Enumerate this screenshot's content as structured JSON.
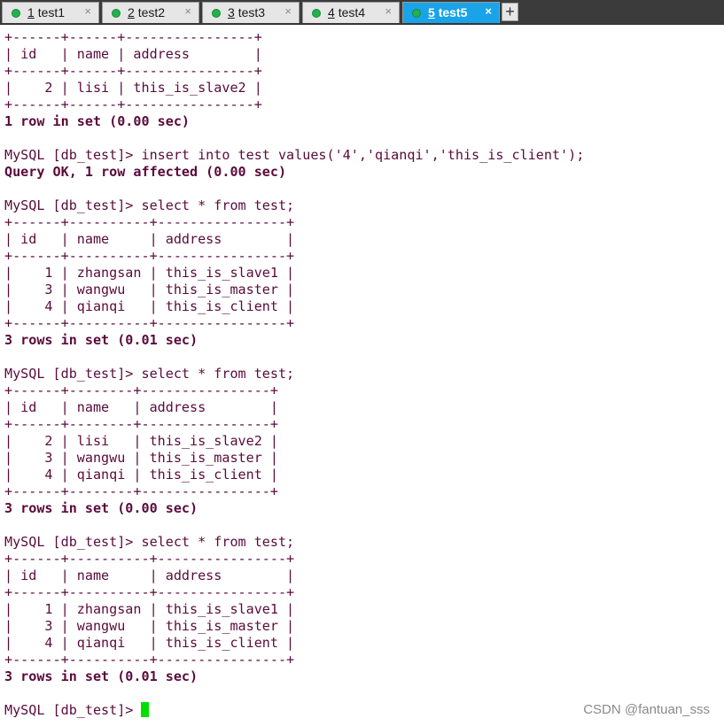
{
  "tabs": [
    {
      "number": "1",
      "name": "test1",
      "close": "×",
      "status_color": "#22b14c"
    },
    {
      "number": "2",
      "name": "test2",
      "close": "×",
      "status_color": "#22b14c"
    },
    {
      "number": "3",
      "name": "test3",
      "close": "×",
      "status_color": "#22b14c"
    },
    {
      "number": "4",
      "name": "test4",
      "close": "×",
      "status_color": "#22b14c"
    },
    {
      "number": "5",
      "name": "test5",
      "close": "×",
      "status_color": "#22b14c",
      "active": true
    }
  ],
  "new_tab": "+",
  "terminal": {
    "lines": [
      "+------+------+----------------+",
      "| id   | name | address        |",
      "+------+------+----------------+",
      "|    2 | lisi | this_is_slave2 |",
      "+------+------+----------------+",
      "1 row in set (0.00 sec)",
      "",
      "MySQL [db_test]> insert into test values('4','qianqi','this_is_client');",
      "Query OK, 1 row affected (0.00 sec)",
      "",
      "MySQL [db_test]> select * from test;",
      "+------+----------+----------------+",
      "| id   | name     | address        |",
      "+------+----------+----------------+",
      "|    1 | zhangsan | this_is_slave1 |",
      "|    3 | wangwu   | this_is_master |",
      "|    4 | qianqi   | this_is_client |",
      "+------+----------+----------------+",
      "3 rows in set (0.01 sec)",
      "",
      "MySQL [db_test]> select * from test;",
      "+------+--------+----------------+",
      "| id   | name   | address        |",
      "+------+--------+----------------+",
      "|    2 | lisi   | this_is_slave2 |",
      "|    3 | wangwu | this_is_master |",
      "|    4 | qianqi | this_is_client |",
      "+------+--------+----------------+",
      "3 rows in set (0.00 sec)",
      "",
      "MySQL [db_test]> select * from test;",
      "+------+----------+----------------+",
      "| id   | name     | address        |",
      "+------+----------+----------------+",
      "|    1 | zhangsan | this_is_slave1 |",
      "|    3 | wangwu   | this_is_master |",
      "|    4 | qianqi   | this_is_client |",
      "+------+----------+----------------+",
      "3 rows in set (0.01 sec)",
      "",
      "MySQL [db_test]> "
    ],
    "bold_lines": [
      5,
      8,
      18,
      28,
      38
    ],
    "text_color": "#5a0a3a",
    "cursor_color": "#00e000"
  },
  "watermark": "CSDN @fantuan_sss"
}
